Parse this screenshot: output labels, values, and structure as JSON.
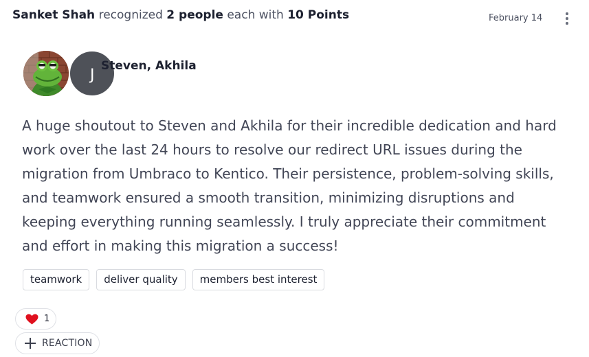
{
  "post": {
    "giver": "Sanket Shah",
    "verb": "recognized",
    "people_count": "2 people",
    "each_with": "each with",
    "points": "10 Points",
    "date": "February 14"
  },
  "recipients": {
    "names": "Steven, Akhila",
    "second_avatar_initial": "J"
  },
  "message": "A huge shoutout to Steven and Akhila for their incredible dedication and hard work over the last 24 hours to resolve our redirect URL issues during the migration from Umbraco to Kentico. Their persistence, problem-solving skills, and teamwork ensured a smooth transition, minimizing disruptions and keeping everything running seamlessly. I truly appreciate their commitment and effort in making this migration a success!",
  "tags": [
    "teamwork",
    "deliver quality",
    "members best interest"
  ],
  "reactions": {
    "heart_count": "1",
    "add_label": "REACTION"
  },
  "icons": {
    "heart": "heart-icon",
    "add": "plus-icon",
    "menu": "more-vertical-icon"
  },
  "colors": {
    "heart": "#e0101e",
    "text": "#1d2130",
    "muted_text": "#424656",
    "border": "#d9dbe0"
  }
}
